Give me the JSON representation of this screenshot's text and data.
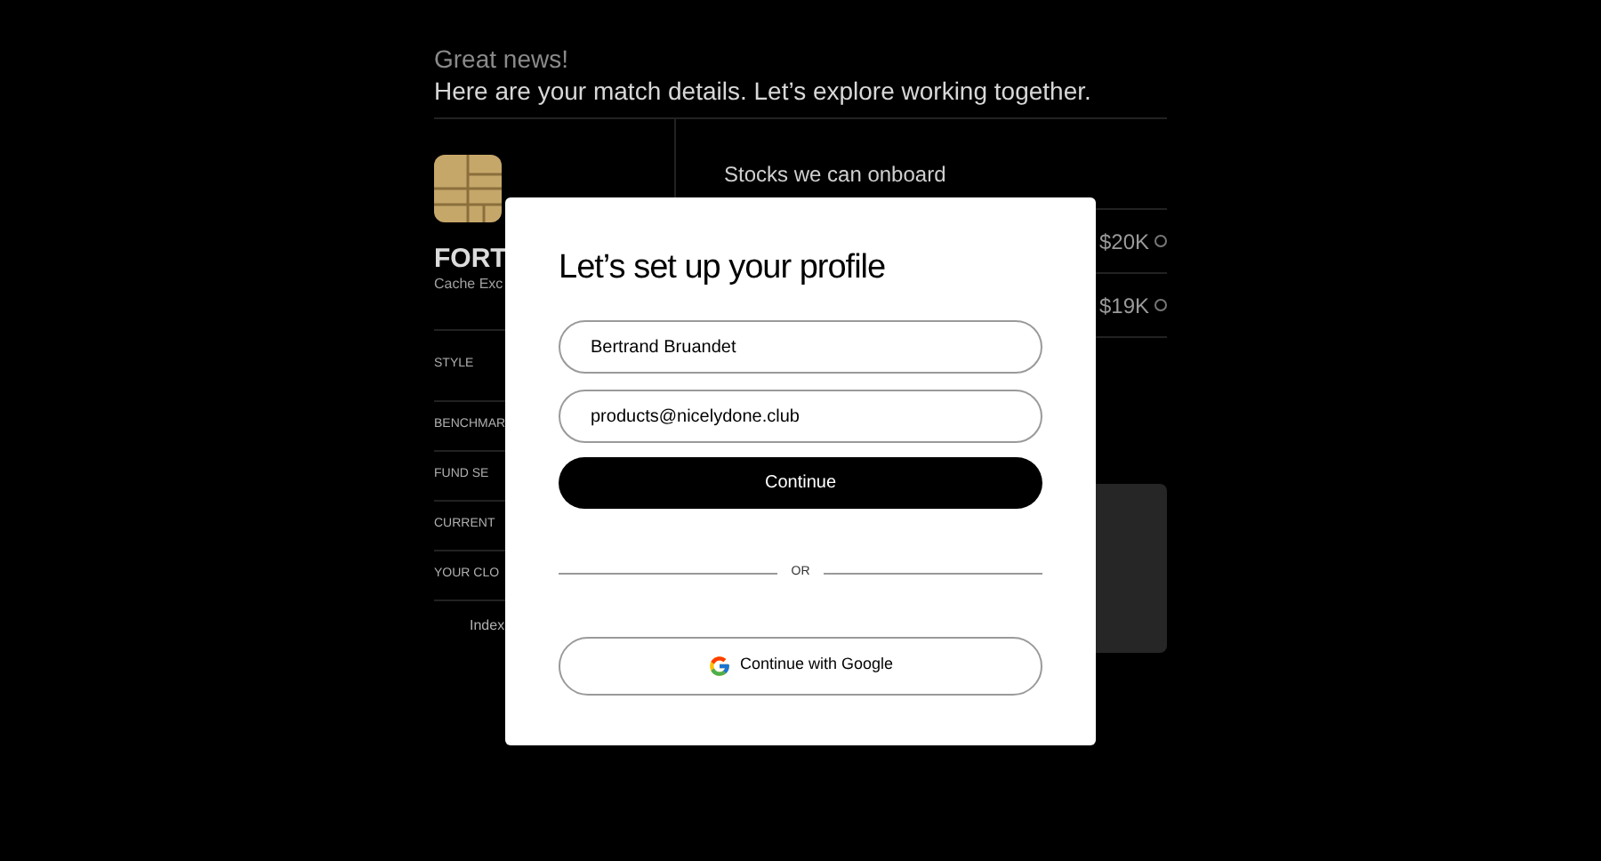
{
  "background": {
    "greeting": "Great news!",
    "headline": "Here are your match details. Let’s explore working together.",
    "fund_name": "FORT",
    "fund_subtitle": "Cache Exc",
    "detail_rows": [
      {
        "label": "STYLE"
      },
      {
        "label": "BENCHMAR"
      },
      {
        "label": "FUND SE"
      },
      {
        "label": "CURRENT"
      },
      {
        "label": "YOUR CLO"
      }
    ],
    "detail_value": "Index",
    "stocks_title": "Stocks we can onboard",
    "stocks": [
      {
        "amount": "$20K"
      },
      {
        "amount": "$19K"
      }
    ]
  },
  "dialog": {
    "title": "Let’s set up your profile",
    "name_field": {
      "value": "Bertrand Bruandet"
    },
    "email_field": {
      "value": "products@nicelydone.club"
    },
    "continue_button": "Continue",
    "divider_label": "OR",
    "google_button": "Continue with Google"
  }
}
